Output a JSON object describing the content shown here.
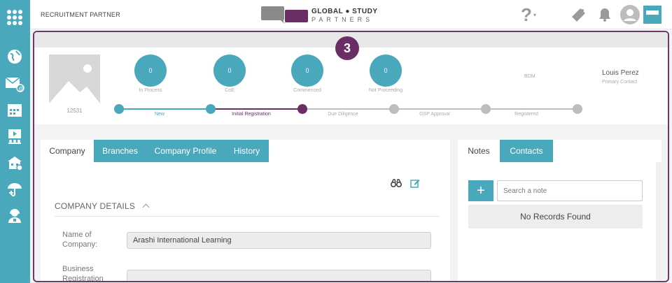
{
  "header": {
    "brand": "RECRUITMENT PARTNER",
    "logo_line1": "GLOBAL ● STUDY",
    "logo_line2": "PARTNERS"
  },
  "badge": {
    "step": "3"
  },
  "summary": {
    "company_id": "12531",
    "stats": [
      {
        "value": "0",
        "label": "In Process"
      },
      {
        "value": "0",
        "label": "CoE"
      },
      {
        "value": "0",
        "label": "Commenced"
      },
      {
        "value": "0",
        "label": "Not Proceeding"
      }
    ],
    "steps": [
      {
        "label": "New",
        "state": "done"
      },
      {
        "label": "Initial Registration",
        "state": "current"
      },
      {
        "label": "Due Diligence",
        "state": "pending"
      },
      {
        "label": "GSP Approval",
        "state": "pending"
      },
      {
        "label": "Registered",
        "state": "pending"
      }
    ],
    "bdm": "BDM",
    "contact_name": "Louis Perez",
    "contact_role": "Primary Contact"
  },
  "company_card": {
    "tabs": [
      "Company",
      "Branches",
      "Company Profile",
      "History"
    ],
    "active_tab": "Company",
    "section_title": "COMPANY DETAILS",
    "fields": [
      {
        "label_line1": "Name of",
        "label_line2": "Company:",
        "value": "Arashi International Learning"
      },
      {
        "label_line1": "Business",
        "label_line2": "Registration",
        "value": ""
      }
    ]
  },
  "notes_card": {
    "tabs": [
      "Notes",
      "Contacts"
    ],
    "active_tab": "Notes",
    "search_placeholder": "Search a note",
    "empty_text": "No Records Found"
  },
  "colors": {
    "accent": "#4aa8bd",
    "purple": "#6b2d66",
    "progress_grey": "#bdbdbd"
  }
}
